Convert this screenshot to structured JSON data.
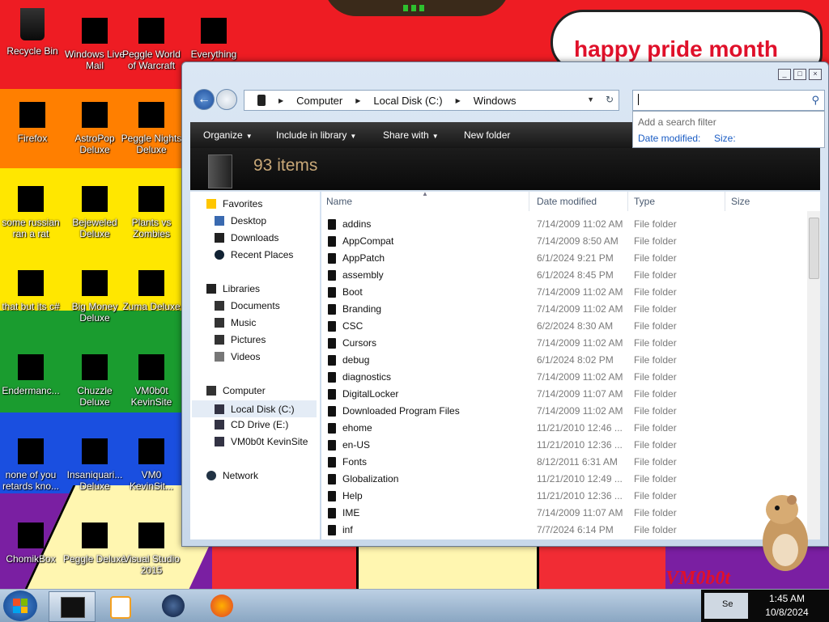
{
  "wallpaper": {
    "banner_text": "happy pride month",
    "corner_text": "VM0b0t",
    "colors": [
      "#ee1c23",
      "#ff7f00",
      "#ffe700",
      "#1a9c2f",
      "#1a4fe0",
      "#7a1fa2"
    ]
  },
  "desktop_icons": [
    {
      "label": "Recycle Bin"
    },
    {
      "label": "Windows Live Mail"
    },
    {
      "label": "Peggle World of Warcraft"
    },
    {
      "label": "Everything"
    },
    {
      "label": "Firefox"
    },
    {
      "label": "AstroPop Deluxe"
    },
    {
      "label": "Peggle Nights Deluxe"
    },
    {
      "label": "some russian ran a rat"
    },
    {
      "label": "Bejeweled Deluxe"
    },
    {
      "label": "Plants vs Zombies"
    },
    {
      "label": "that but its c#"
    },
    {
      "label": "Big Money Deluxe"
    },
    {
      "label": "Zuma Deluxe"
    },
    {
      "label": "Endermanc..."
    },
    {
      "label": "Chuzzle Deluxe"
    },
    {
      "label": "VM0b0t KevinSite"
    },
    {
      "label": "none of you retards kno..."
    },
    {
      "label": "Insaniquari... Deluxe"
    },
    {
      "label": "VM0 KevinSit..."
    },
    {
      "label": "ChomikBox"
    },
    {
      "label": "Peggle Deluxe"
    },
    {
      "label": "Visual Studio 2015"
    }
  ],
  "explorer": {
    "breadcrumb": [
      "Computer",
      "Local Disk (C:)",
      "Windows"
    ],
    "search": {
      "hint": "Add a search filter",
      "filters": [
        "Date modified:",
        "Size:"
      ]
    },
    "toolbar": {
      "organize": "Organize",
      "include": "Include in library",
      "share": "Share with",
      "new_folder": "New folder"
    },
    "items_count": "93 items",
    "nav": {
      "favorites": "Favorites",
      "favorites_items": [
        "Desktop",
        "Downloads",
        "Recent Places"
      ],
      "libraries": "Libraries",
      "libraries_items": [
        "Documents",
        "Music",
        "Pictures",
        "Videos"
      ],
      "computer": "Computer",
      "computer_items": [
        "Local Disk (C:)",
        "CD Drive (E:)",
        "VM0b0t KevinSite"
      ],
      "network": "Network"
    },
    "columns": {
      "name": "Name",
      "date": "Date modified",
      "type": "Type",
      "size": "Size"
    },
    "files": [
      {
        "name": "addins",
        "date": "7/14/2009 11:02 AM",
        "type": "File folder"
      },
      {
        "name": "AppCompat",
        "date": "7/14/2009 8:50 AM",
        "type": "File folder"
      },
      {
        "name": "AppPatch",
        "date": "6/1/2024 9:21 PM",
        "type": "File folder"
      },
      {
        "name": "assembly",
        "date": "6/1/2024 8:45 PM",
        "type": "File folder"
      },
      {
        "name": "Boot",
        "date": "7/14/2009 11:02 AM",
        "type": "File folder"
      },
      {
        "name": "Branding",
        "date": "7/14/2009 11:02 AM",
        "type": "File folder"
      },
      {
        "name": "CSC",
        "date": "6/2/2024 8:30 AM",
        "type": "File folder"
      },
      {
        "name": "Cursors",
        "date": "7/14/2009 11:02 AM",
        "type": "File folder"
      },
      {
        "name": "debug",
        "date": "6/1/2024 8:02 PM",
        "type": "File folder"
      },
      {
        "name": "diagnostics",
        "date": "7/14/2009 11:02 AM",
        "type": "File folder"
      },
      {
        "name": "DigitalLocker",
        "date": "7/14/2009 11:07 AM",
        "type": "File folder"
      },
      {
        "name": "Downloaded Program Files",
        "date": "7/14/2009 11:02 AM",
        "type": "File folder"
      },
      {
        "name": "ehome",
        "date": "11/21/2010 12:46 ...",
        "type": "File folder"
      },
      {
        "name": "en-US",
        "date": "11/21/2010 12:36 ...",
        "type": "File folder"
      },
      {
        "name": "Fonts",
        "date": "8/12/2011 6:31 AM",
        "type": "File folder"
      },
      {
        "name": "Globalization",
        "date": "11/21/2010 12:49 ...",
        "type": "File folder"
      },
      {
        "name": "Help",
        "date": "11/21/2010 12:36 ...",
        "type": "File folder"
      },
      {
        "name": "IME",
        "date": "7/14/2009 11:07 AM",
        "type": "File folder"
      },
      {
        "name": "inf",
        "date": "7/7/2024 6:14 PM",
        "type": "File folder"
      }
    ]
  },
  "taskbar": {
    "time": "1:45 AM",
    "date": "10/8/2024",
    "tray_text": "Se"
  }
}
